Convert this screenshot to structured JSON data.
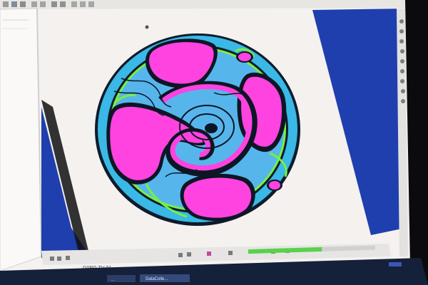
{
  "window": {
    "background_color": "#f4f1ef",
    "accent_blue": "#1f3fae",
    "monitor_bezel_color": "#0b0b0d"
  },
  "toolbar_row": {
    "icon_names": [
      "new-icon",
      "open-icon",
      "save-icon",
      "undo-icon",
      "redo-icon",
      "copy-icon",
      "paste-icon",
      "zoom-icon",
      "pan-icon",
      "rotate-icon"
    ]
  },
  "status_bar": {
    "coordinate_text": "G0RG TV-01",
    "progress_fraction": 0.58,
    "progress_color": "#59d14a"
  },
  "taskbar": {
    "button_label": "...",
    "app_label": "DataColle..."
  },
  "model_view": {
    "colors": {
      "outer_ring": "#3ab8e6",
      "outer_rim_dark": "#0e1b2a",
      "pocket_magenta": "#ff43e0",
      "edge_green": "#78ef44",
      "inner_ring_blue": "#56b6ec",
      "shadow": "#0d1625"
    }
  }
}
